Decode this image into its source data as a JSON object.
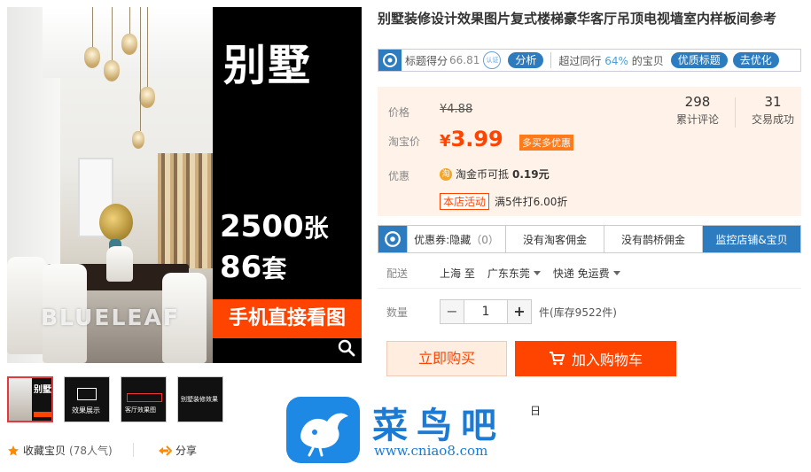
{
  "gallery": {
    "main": {
      "promo_title": "别墅",
      "count_number": "2500",
      "count_unit": "张",
      "sets_number": "86",
      "sets_unit": "套",
      "banner": "手机直接看图",
      "watermark": "BLUELEAF"
    },
    "thumbs": [
      {
        "text": "别墅"
      },
      {
        "text": "效果展示"
      },
      {
        "text": "客厅效果图"
      },
      {
        "text": "别墅装修效果"
      }
    ]
  },
  "actions": {
    "favorite_label": "收藏宝贝",
    "favorite_count": "(78人气)",
    "share_label": "分享"
  },
  "product": {
    "title": "别墅装修设计效果图片复式楼梯豪华客厅吊顶电视墙室内样板间参考",
    "score": {
      "label": "标题得分",
      "value": "66.81",
      "seal_text": "认证",
      "analyze_btn": "分析",
      "beat_prefix": "超过同行",
      "beat_pct": "64%",
      "beat_suffix": "的宝贝",
      "optimize_title_btn": "优质标题",
      "go_optimize_btn": "去优化"
    },
    "price": {
      "label": "价格",
      "original": "¥4.88",
      "tb_label": "淘宝价",
      "currency": "¥",
      "current": "3.99",
      "promo_tag": "多买多优惠"
    },
    "stats": [
      {
        "num": "298",
        "label": "累计评论"
      },
      {
        "num": "31",
        "label": "交易成功"
      }
    ],
    "discount": {
      "label": "优惠",
      "coin_icon": "淘",
      "coin_text": "淘金币可抵",
      "coin_amount": "0.19元",
      "shop_tag": "本店活动",
      "shop_text": "满5件打6.00折"
    },
    "tabs": [
      {
        "label": "优惠券:隐藏",
        "extra": "（0）"
      },
      {
        "label": "没有淘客佣金",
        "extra": ""
      },
      {
        "label": "没有鹊桥佣金",
        "extra": ""
      },
      {
        "label": "监控店铺&宝贝",
        "extra": ""
      }
    ],
    "delivery": {
      "label": "配送",
      "from": "上海 至",
      "to": "广东东莞",
      "method": "快递 免运费"
    },
    "quantity": {
      "label": "数量",
      "minus": "−",
      "value": "1",
      "plus": "+",
      "stock": "件(库存9522件)"
    },
    "buy_now": "立即购买",
    "add_cart": "加入购物车"
  },
  "overlay": {
    "brand_cn": "菜鸟吧",
    "brand_url": "www.cniao8.com",
    "stray_char": "日"
  },
  "colors": {
    "accent": "#ff4400",
    "blue": "#2d7cbf",
    "price_bg": "#fff2e8"
  }
}
